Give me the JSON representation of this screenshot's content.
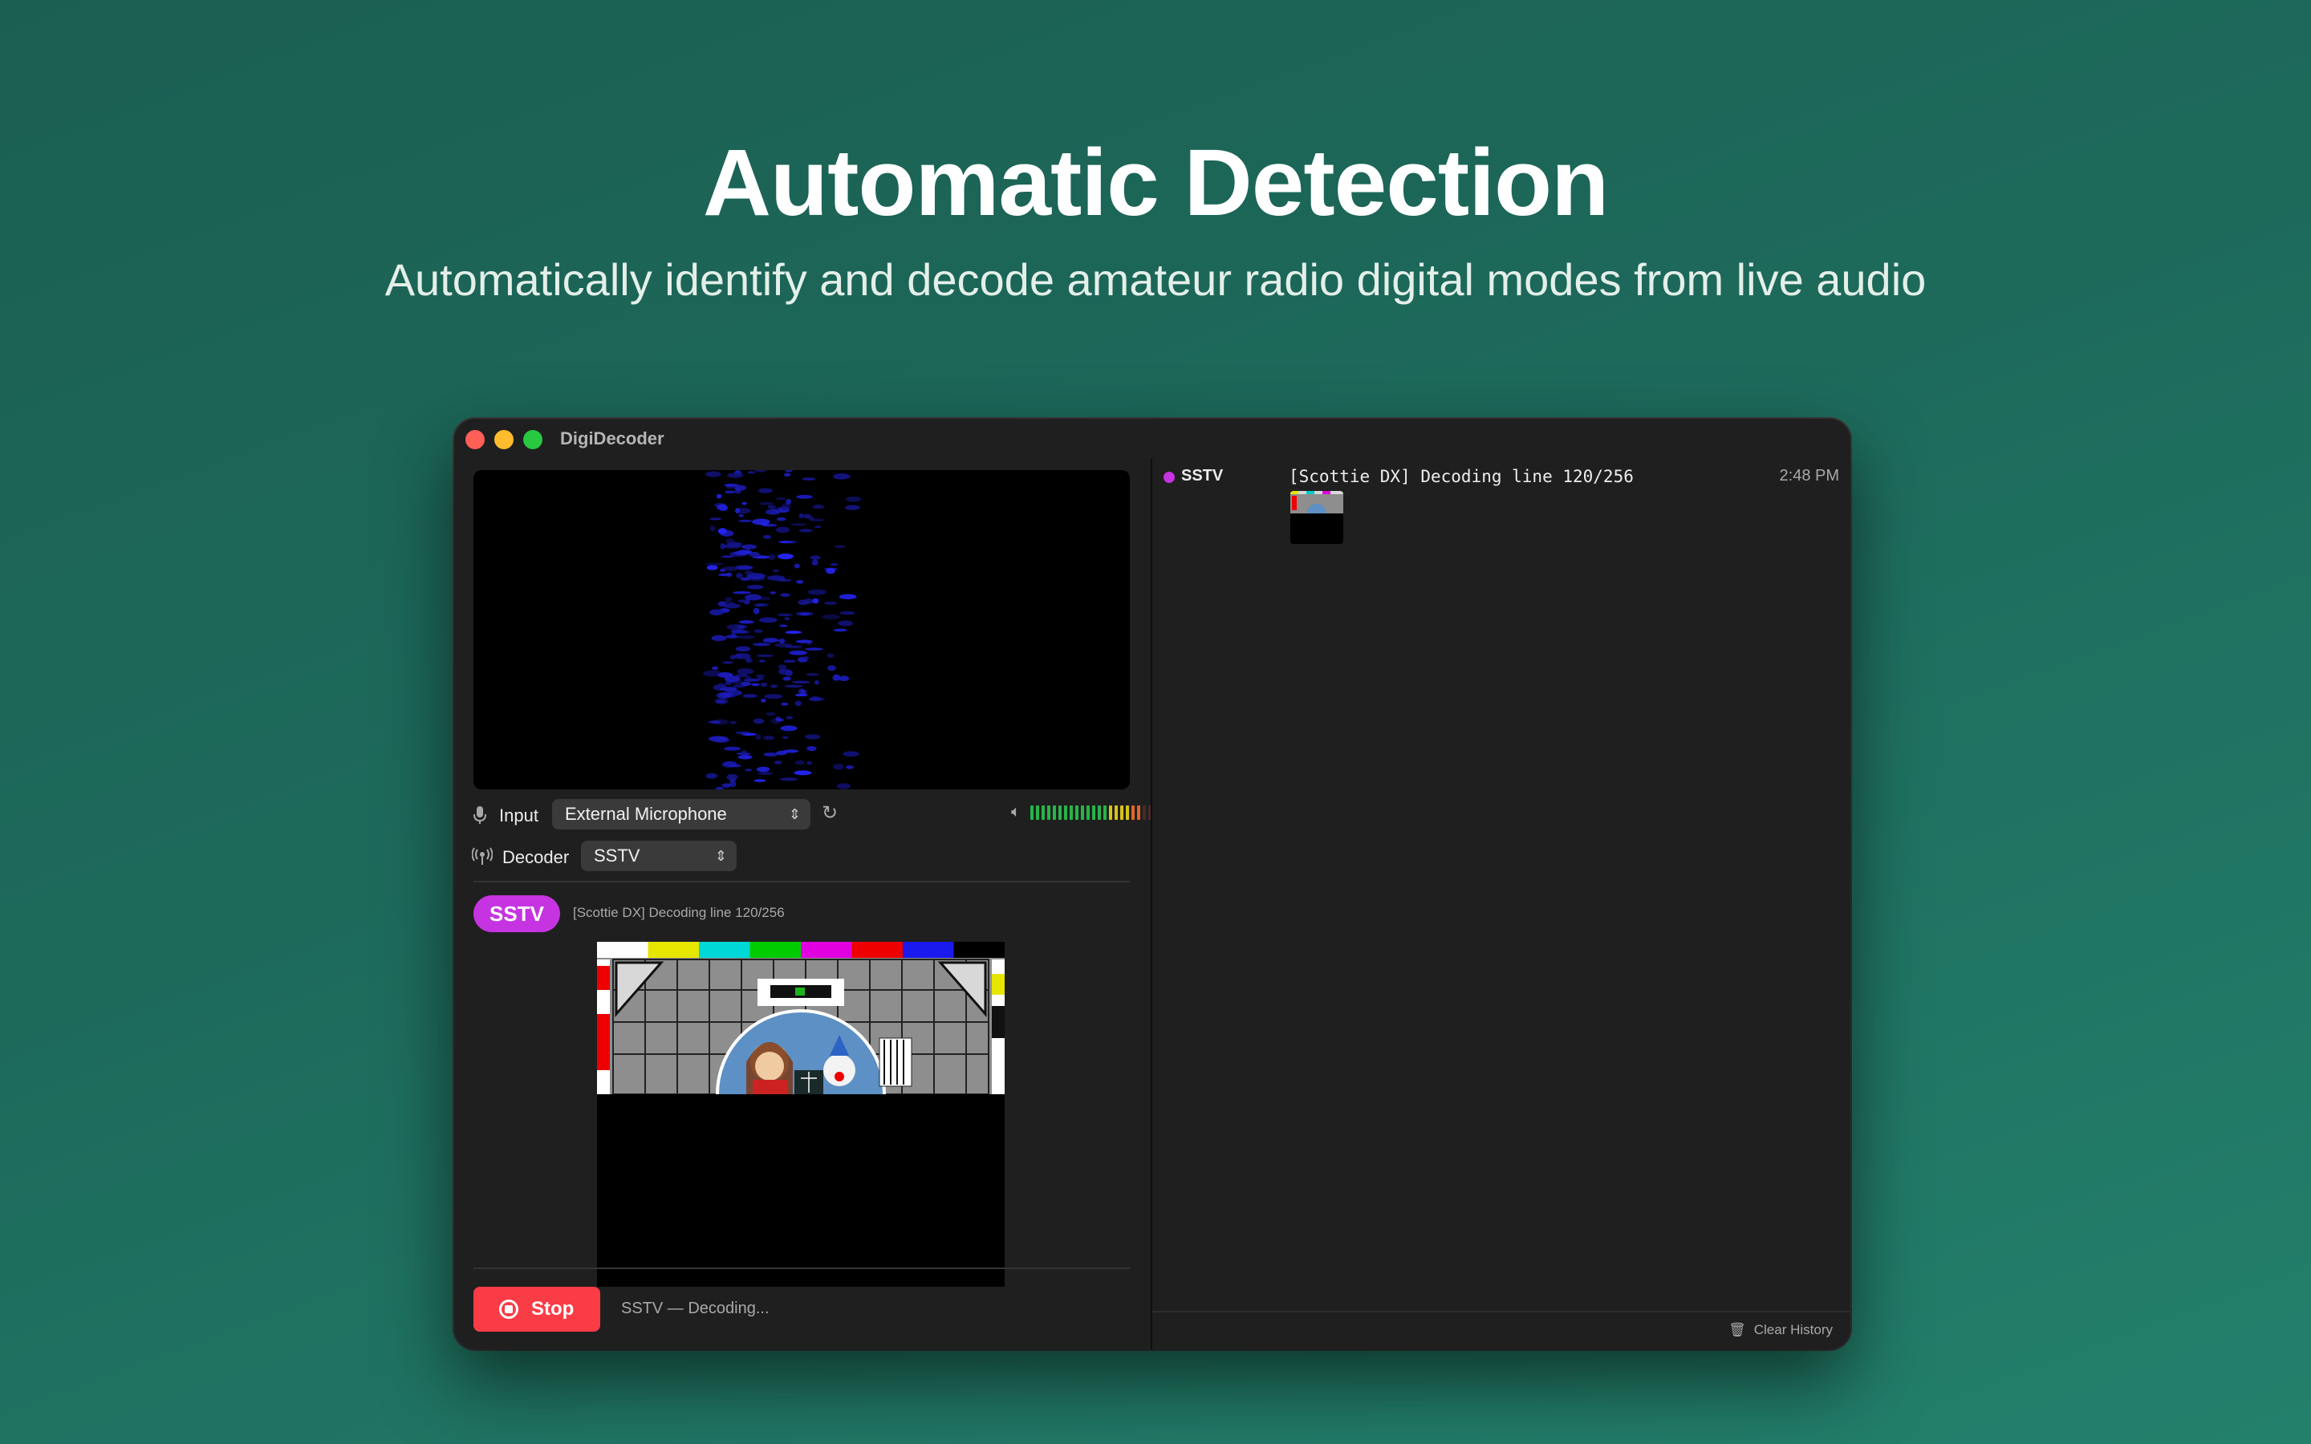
{
  "hero": {
    "title": "Automatic Detection",
    "subtitle": "Automatically identify and decode amateur radio digital modes from live audio"
  },
  "window": {
    "title": "DigiDecoder"
  },
  "controls": {
    "input_label": "Input",
    "input_value": "External Microphone",
    "decoder_label": "Decoder",
    "decoder_value": "SSTV",
    "mic_icon": "microphone-icon",
    "refresh_icon": "refresh-icon",
    "speaker_icon": "speaker-icon",
    "antenna_icon": "antenna-icon",
    "level_meter_fraction": 0.9
  },
  "decoder_panel": {
    "mode_badge": "SSTV",
    "status_text": "[Scottie DX] Decoding line 120/256",
    "decode_progress_fraction": 0.47,
    "badge_color": "#c534e0"
  },
  "footer": {
    "stop_label": "Stop",
    "status_text": "SSTV — Decoding...",
    "stop_color": "#fa3c46"
  },
  "history": {
    "items": [
      {
        "mode": "SSTV",
        "message": "[Scottie DX] Decoding line 120/256",
        "time": "2:48 PM",
        "dot_color": "#c534e0"
      }
    ],
    "clear_label": "Clear History"
  }
}
